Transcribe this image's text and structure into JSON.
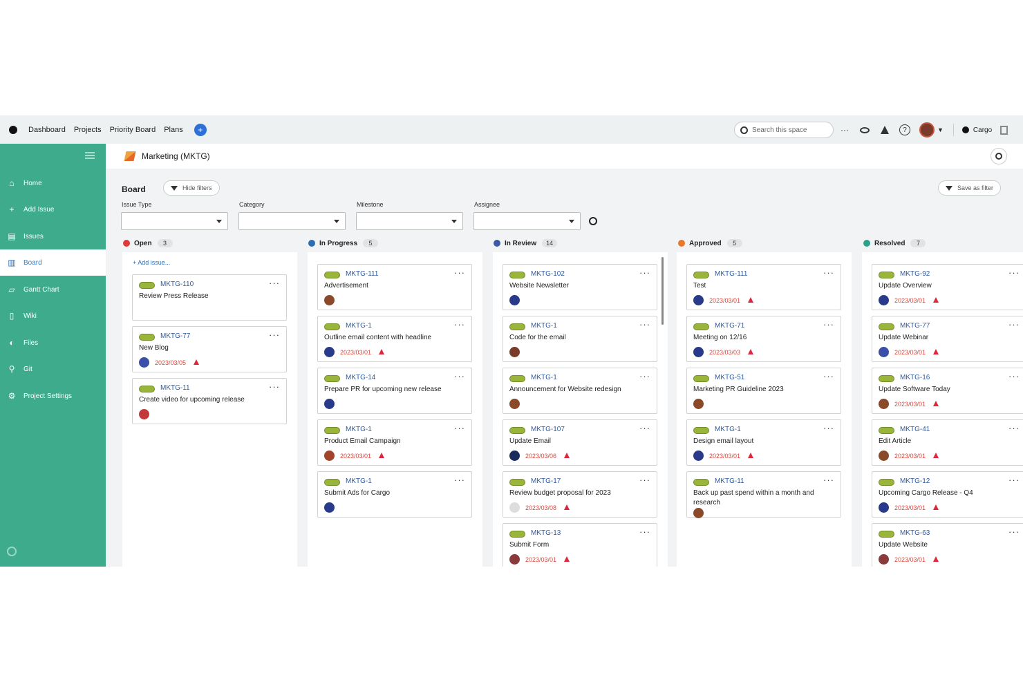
{
  "topnav": {
    "links": [
      "Dashboard",
      "Projects",
      "Priority Board",
      "Plans"
    ],
    "search_placeholder": "Search this space",
    "org": "Cargo"
  },
  "sidebar": {
    "items": [
      {
        "label": "Home",
        "icon": "home-icon"
      },
      {
        "label": "Add Issue",
        "icon": "plus-icon"
      },
      {
        "label": "Issues",
        "icon": "list-icon"
      },
      {
        "label": "Board",
        "icon": "board-icon"
      },
      {
        "label": "Gantt Chart",
        "icon": "gantt-icon"
      },
      {
        "label": "Wiki",
        "icon": "wiki-icon"
      },
      {
        "label": "Files",
        "icon": "files-icon"
      },
      {
        "label": "Git",
        "icon": "git-icon"
      },
      {
        "label": "Project Settings",
        "icon": "settings-icon"
      }
    ],
    "active_index": 3
  },
  "project": {
    "name": "Marketing (MKTG)"
  },
  "board": {
    "title": "Board",
    "hide_filters_label": "Hide filters",
    "save_filter_label": "Save as filter",
    "filters": [
      {
        "label": "Issue Type",
        "value": ""
      },
      {
        "label": "Category",
        "value": ""
      },
      {
        "label": "Milestone",
        "value": ""
      },
      {
        "label": "Assignee",
        "value": ""
      }
    ],
    "add_issue_label": "+ Add issue..."
  },
  "columns": [
    {
      "name": "Open",
      "count": "3",
      "color": "#e03a3a",
      "cards": [
        {
          "id": "MKTG-110",
          "title": "Review Press Release",
          "date": "",
          "avatar": "",
          "flag": false
        },
        {
          "id": "MKTG-77",
          "title": "New Blog",
          "date": "2023/03/05",
          "avatar": "#3a4fa8",
          "flag": true
        },
        {
          "id": "MKTG-11",
          "title": "Create video for upcoming release",
          "date": "",
          "avatar": "#c43a3a",
          "flag": false
        }
      ]
    },
    {
      "name": "In Progress",
      "count": "5",
      "color": "#2d6db3",
      "cards": [
        {
          "id": "MKTG-111",
          "title": "Advertisement",
          "date": "",
          "avatar": "#8a4a2a",
          "flag": false
        },
        {
          "id": "MKTG-1",
          "title": "Outline email content with headline",
          "date": "2023/03/01",
          "avatar": "#2a3a8a",
          "flag": true
        },
        {
          "id": "MKTG-14",
          "title": "Prepare PR for upcoming new release",
          "date": "",
          "avatar": "#2a3a8a",
          "flag": false
        },
        {
          "id": "MKTG-1",
          "title": "Product Email Campaign",
          "date": "2023/03/01",
          "avatar": "#a3442a",
          "flag": true
        },
        {
          "id": "MKTG-1",
          "title": "Submit Ads for Cargo",
          "date": "",
          "avatar": "#2a3a8a",
          "flag": false
        }
      ]
    },
    {
      "name": "In Review",
      "count": "14",
      "color": "#3a5aa3",
      "cards": [
        {
          "id": "MKTG-102",
          "title": "Website Newsletter",
          "date": "",
          "avatar": "#2a3a8a",
          "flag": false
        },
        {
          "id": "MKTG-1",
          "title": "Code for the email",
          "date": "",
          "avatar": "#7a3b2a",
          "flag": false
        },
        {
          "id": "MKTG-1",
          "title": "Announcement for Website redesign",
          "date": "",
          "avatar": "#8a4a2a",
          "flag": false
        },
        {
          "id": "MKTG-107",
          "title": "Update Email",
          "date": "2023/03/06",
          "avatar": "#1a2a5a",
          "flag": true
        },
        {
          "id": "MKTG-17",
          "title": "Review budget proposal for 2023",
          "date": "2023/03/08",
          "avatar": "#dddddd",
          "flag": true
        },
        {
          "id": "MKTG-13",
          "title": "Submit Form",
          "date": "2023/03/01",
          "avatar": "#8a3a3a",
          "flag": true
        }
      ]
    },
    {
      "name": "Approved",
      "count": "5",
      "color": "#e8782a",
      "cards": [
        {
          "id": "MKTG-111",
          "title": "Test",
          "date": "2023/03/01",
          "avatar": "#2a3a8a",
          "flag": true
        },
        {
          "id": "MKTG-71",
          "title": "Meeting on 12/16",
          "date": "2023/03/03",
          "avatar": "#2a3a8a",
          "flag": true
        },
        {
          "id": "MKTG-51",
          "title": "Marketing PR Guideline 2023",
          "date": "",
          "avatar": "#8a4a2a",
          "flag": false
        },
        {
          "id": "MKTG-1",
          "title": "Design email layout",
          "date": "2023/03/01",
          "avatar": "#2a3a8a",
          "flag": true
        },
        {
          "id": "MKTG-11",
          "title": "Back up past spend within a month and research",
          "date": "",
          "avatar": "#8a4a2a",
          "flag": false
        }
      ]
    },
    {
      "name": "Resolved",
      "count": "7",
      "color": "#2aa38a",
      "cards": [
        {
          "id": "MKTG-92",
          "title": "Update Overview",
          "date": "2023/03/01",
          "avatar": "#2a3a8a",
          "flag": true
        },
        {
          "id": "MKTG-77",
          "title": "Update Webinar",
          "date": "2023/03/01",
          "avatar": "#3a4fa8",
          "flag": true
        },
        {
          "id": "MKTG-16",
          "title": "Update Software Today",
          "date": "2023/03/01",
          "avatar": "#8a4a2a",
          "flag": true
        },
        {
          "id": "MKTG-41",
          "title": "Edit Article",
          "date": "2023/03/01",
          "avatar": "#8a4a2a",
          "flag": true
        },
        {
          "id": "MKTG-12",
          "title": "Upcoming Cargo Release - Q4",
          "date": "2023/03/01",
          "avatar": "#2a3a8a",
          "flag": true
        },
        {
          "id": "MKTG-63",
          "title": "Update Website",
          "date": "2023/03/01",
          "avatar": "#8a3a3a",
          "flag": true
        }
      ]
    }
  ]
}
